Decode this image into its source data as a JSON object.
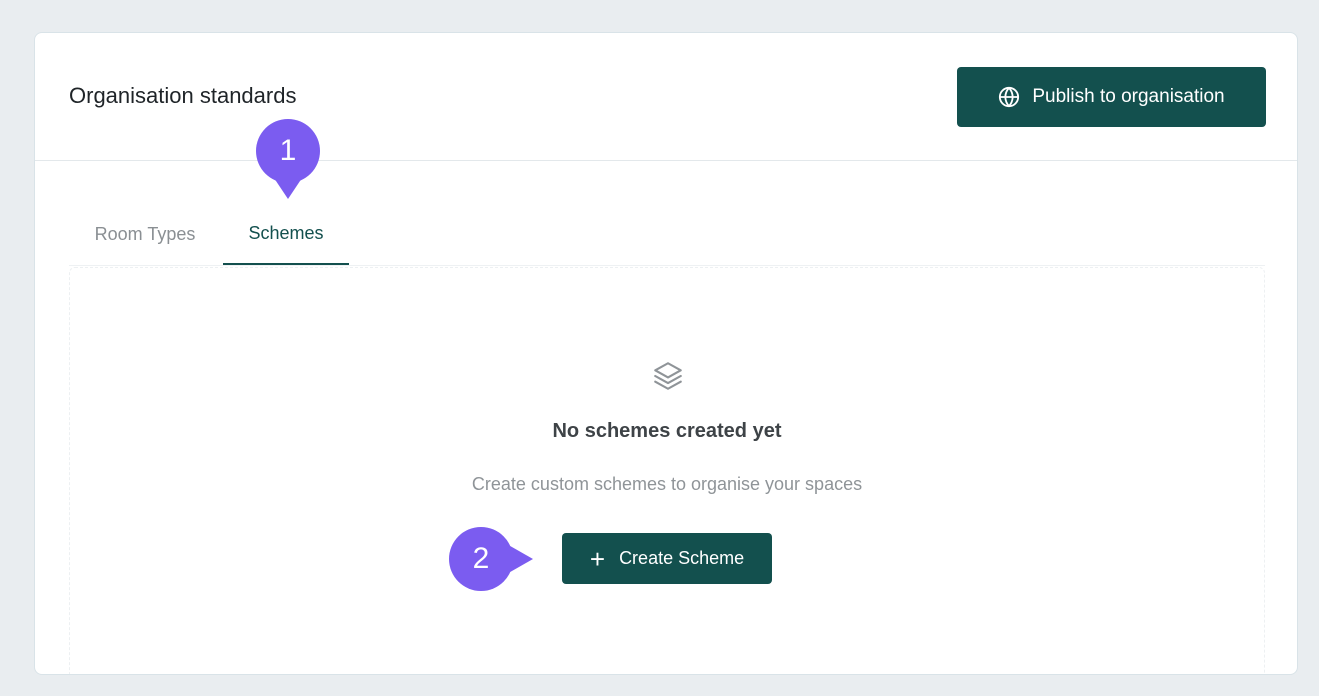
{
  "header": {
    "title": "Organisation standards",
    "publish_label": "Publish to organisation",
    "publish_icon": "globe-icon"
  },
  "tabs": [
    {
      "label": "Room Types",
      "active": false
    },
    {
      "label": "Schemes",
      "active": true
    }
  ],
  "empty_state": {
    "icon": "layers-icon",
    "title": "No schemes created yet",
    "subtitle": "Create custom schemes to organise your spaces",
    "button_label": "Create Scheme",
    "button_icon": "plus-icon"
  },
  "step_markers": [
    {
      "number": "1"
    },
    {
      "number": "2"
    }
  ],
  "colors": {
    "primary": "#13504e",
    "marker": "#7b5cf0",
    "background": "#e9edf0",
    "card": "#ffffff"
  }
}
